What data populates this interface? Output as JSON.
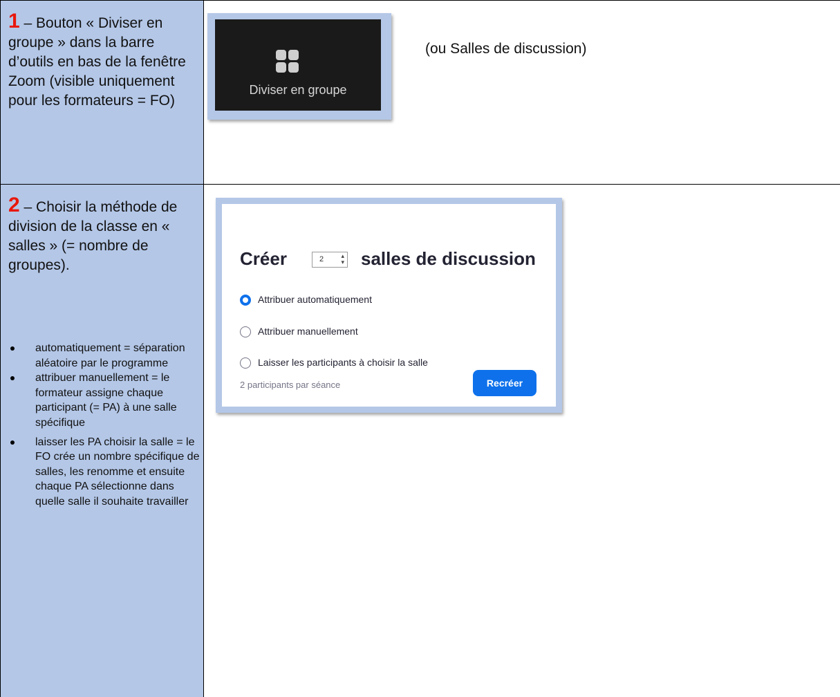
{
  "step1": {
    "number": "1",
    "text": " – Bouton « Diviser en groupe » dans la barre d’outils en bas de la fenêtre Zoom (visible uniquement pour les formateurs = FO)",
    "toolbar_button_label": "Diviser en groupe",
    "note": "(ou Salles de discussion)"
  },
  "step2": {
    "number": "2",
    "text": " – Choisir la méthode de division de la classe en « salles » (= nombre de groupes).",
    "bullets": [
      "automatiquement = séparation aléatoire par le programme",
      "attribuer manuellement = le formateur assigne chaque participant (= PA) à une salle spécifique",
      "laisser les PA choisir la salle = le FO crée un nombre spécifique de salles, les renomme et ensuite chaque PA sélectionne dans quelle salle il souhaite travailler"
    ]
  },
  "dialog": {
    "create_label": "Créer",
    "room_count": "2",
    "rooms_label": "salles de discussion",
    "options": [
      {
        "label": "Attribuer automatiquement",
        "selected": true
      },
      {
        "label": "Attribuer manuellement",
        "selected": false
      },
      {
        "label": "Laisser les participants à choisir la salle",
        "selected": false
      }
    ],
    "per_session": "2 participants par séance",
    "recreate_button": "Recréer"
  },
  "colors": {
    "cell_background": "#b4c7e7",
    "step_number": "#e8180c",
    "zoom_blue": "#0e71eb"
  }
}
